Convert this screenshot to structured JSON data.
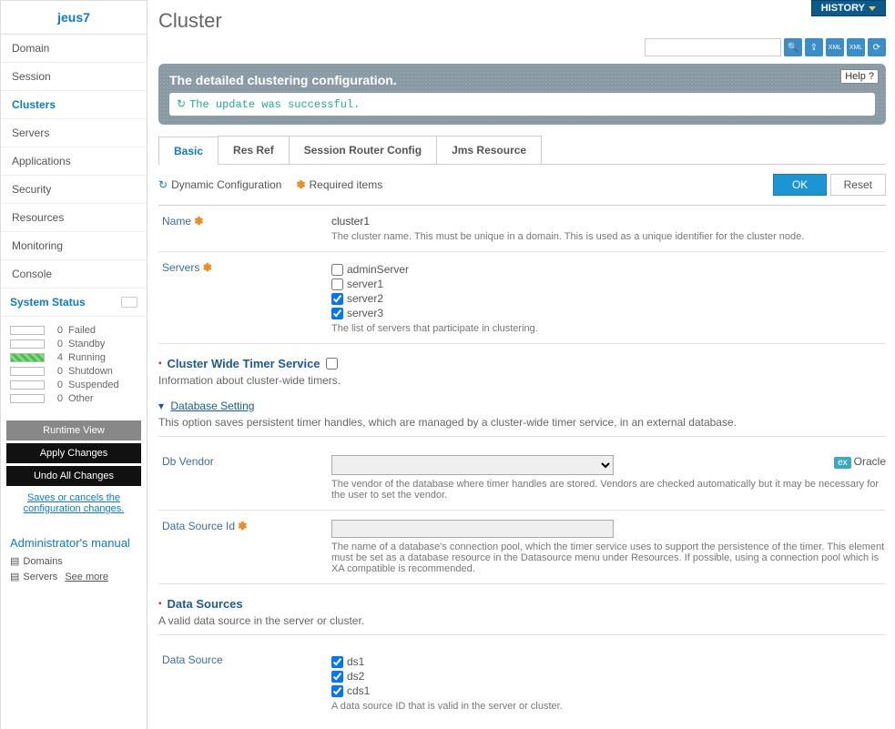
{
  "sidebar": {
    "title": "jeus7",
    "nav": [
      "Domain",
      "Session",
      "Clusters",
      "Servers",
      "Applications",
      "Security",
      "Resources",
      "Monitoring",
      "Console"
    ],
    "activeIndex": 2,
    "statusHeader": "System Status",
    "status": [
      {
        "count": 0,
        "label": "Failed",
        "filled": false
      },
      {
        "count": 0,
        "label": "Standby",
        "filled": false
      },
      {
        "count": 4,
        "label": "Running",
        "filled": true
      },
      {
        "count": 0,
        "label": "Shutdown",
        "filled": false
      },
      {
        "count": 0,
        "label": "Suspended",
        "filled": false
      },
      {
        "count": 0,
        "label": "Other",
        "filled": false
      }
    ],
    "buttons": {
      "runtime": "Runtime View",
      "apply": "Apply Changes",
      "undo": "Undo All Changes"
    },
    "saveNote": "Saves or cancels the configuration changes.",
    "manualTitle": "Administrator's manual",
    "manualLinks": [
      "Domains",
      "Servers"
    ],
    "seeMore": "See more"
  },
  "header": {
    "history": "HISTORY",
    "pageTitle": "Cluster"
  },
  "banner": {
    "title": "The detailed clustering configuration.",
    "help": "Help",
    "success": "The update was successful."
  },
  "tabs": [
    "Basic",
    "Res Ref",
    "Session Router Config",
    "Jms Resource"
  ],
  "legend": {
    "dynamic": "Dynamic Configuration",
    "required": "Required items",
    "ok": "OK",
    "reset": "Reset"
  },
  "form": {
    "name": {
      "label": "Name",
      "value": "cluster1",
      "help": "The cluster name. This must be unique in a domain. This is used as a unique identifier for the cluster node."
    },
    "servers": {
      "label": "Servers",
      "options": [
        {
          "label": "adminServer",
          "checked": false
        },
        {
          "label": "server1",
          "checked": false
        },
        {
          "label": "server2",
          "checked": true
        },
        {
          "label": "server3",
          "checked": true
        }
      ],
      "help": "The list of servers that participate in clustering."
    },
    "timerSection": {
      "title": "Cluster Wide Timer Service",
      "help": "Information about cluster-wide timers."
    },
    "dbSetting": {
      "title": "Database Setting",
      "help": "This option saves persistent timer handles, which are managed by a cluster-wide timer service, in an external database."
    },
    "dbVendor": {
      "label": "Db Vendor",
      "hint": "Oracle",
      "help": "The vendor of the database where timer handles are stored. Vendors are checked automatically but it may be necessary for the user to set the vendor."
    },
    "dataSourceId": {
      "label": "Data Source Id",
      "help": "The name of a database's connection pool, which the timer service uses to support the persistence of the timer. This element must be set as a database resource in the Datasource menu under Resources. If possible, using a connection pool which is XA compatible is recommended."
    },
    "dataSources": {
      "title": "Data Sources",
      "help": "A valid data source in the server or cluster."
    },
    "dataSource": {
      "label": "Data Source",
      "options": [
        {
          "label": "ds1",
          "checked": true
        },
        {
          "label": "ds2",
          "checked": true
        },
        {
          "label": "cds1",
          "checked": true
        }
      ],
      "help": "A data source ID that is valid in the server or cluster."
    }
  }
}
